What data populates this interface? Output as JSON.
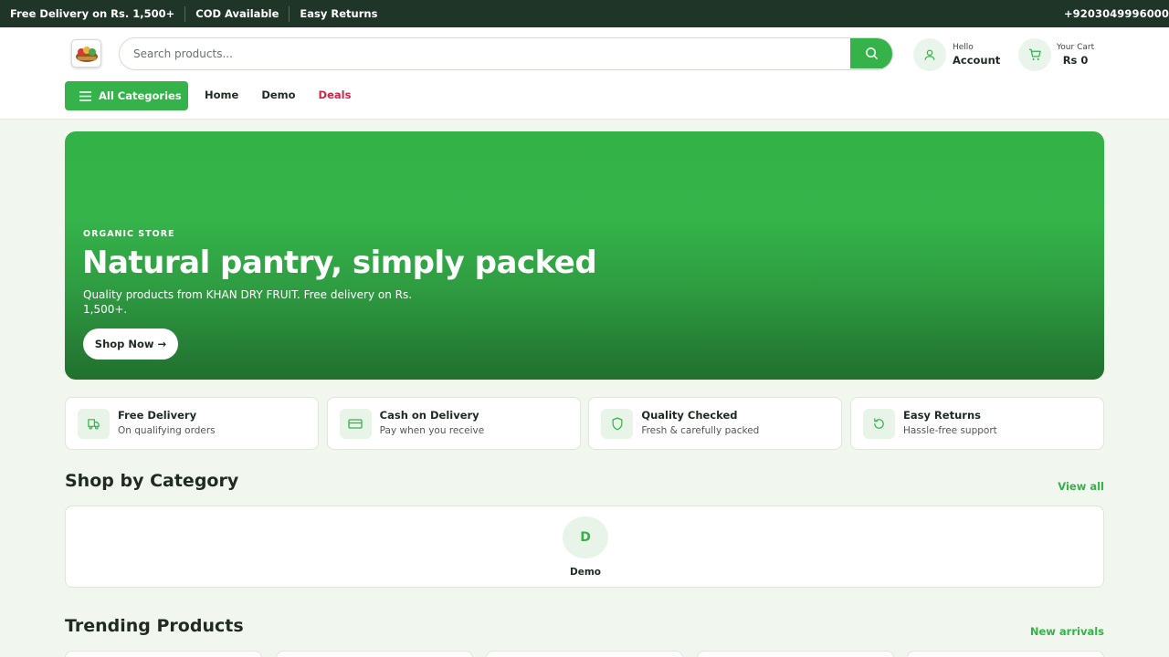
{
  "topbar": {
    "items": [
      "Free Delivery on Rs. 1,500+",
      "COD Available",
      "Easy Returns"
    ],
    "phone": "+9203049996000"
  },
  "header": {
    "search_placeholder": "Search products...",
    "account_hello": "Hello",
    "account_label": "Account",
    "cart_label": "Your Cart",
    "cart_total": "Rs 0"
  },
  "nav": {
    "all_categories": "All Categories",
    "links": [
      "Home",
      "Demo",
      "Deals"
    ]
  },
  "hero": {
    "eyebrow": "ORGANIC STORE",
    "title": "Natural pantry, simply packed",
    "subtitle": "Quality products from KHAN DRY FRUIT. Free delivery on Rs. 1,500+.",
    "cta": "Shop Now →"
  },
  "features": [
    {
      "title": "Free Delivery",
      "subtitle": "On qualifying orders",
      "icon": "truck-icon"
    },
    {
      "title": "Cash on Delivery",
      "subtitle": "Pay when you receive",
      "icon": "card-icon"
    },
    {
      "title": "Quality Checked",
      "subtitle": "Fresh & carefully packed",
      "icon": "shield-icon"
    },
    {
      "title": "Easy Returns",
      "subtitle": "Hassle-free support",
      "icon": "rotate-icon"
    }
  ],
  "categories_section": {
    "title": "Shop by Category",
    "link": "View all",
    "items": [
      {
        "initial": "D",
        "label": "Demo"
      }
    ]
  },
  "trending_section": {
    "title": "Trending Products",
    "link": "New arrivals"
  },
  "colors": {
    "accent": "#35b24a",
    "topbar": "#1f3527",
    "deals": "#d1264c"
  }
}
